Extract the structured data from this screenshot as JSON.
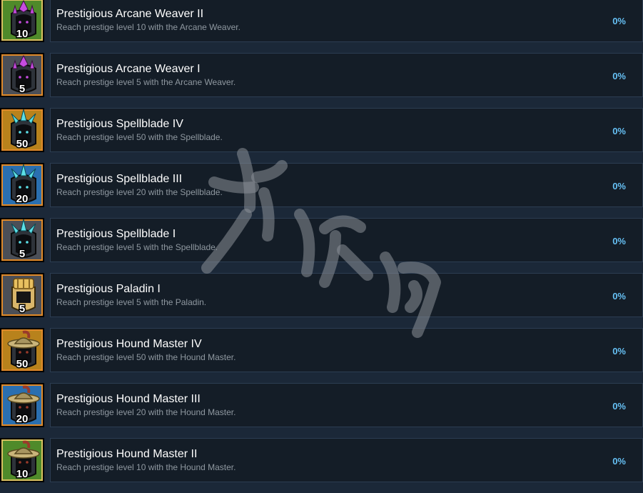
{
  "achievements": [
    {
      "title": "Prestigious Arcane Weaver II",
      "description": "Reach prestige level 10 with the Arcane Weaver.",
      "progress": "0%",
      "level": "10",
      "icon": "arcane-weaver-icon",
      "bg": "#4f8a2a",
      "frame": "#d8c060",
      "crest": "#c64ce0"
    },
    {
      "title": "Prestigious Arcane Weaver I",
      "description": "Reach prestige level 5 with the Arcane Weaver.",
      "progress": "0%",
      "level": "5",
      "icon": "arcane-weaver-icon",
      "bg": "#4b4f57",
      "frame": "#e08a2a",
      "crest": "#c64ce0"
    },
    {
      "title": "Prestigious Spellblade IV",
      "description": "Reach prestige level 50 with the Spellblade.",
      "progress": "0%",
      "level": "50",
      "icon": "spellblade-icon",
      "bg": "#b8821c",
      "frame": "#e08a2a",
      "crest": "#5ce0e8"
    },
    {
      "title": "Prestigious Spellblade III",
      "description": "Reach prestige level 20 with the Spellblade.",
      "progress": "0%",
      "level": "20",
      "icon": "spellblade-icon",
      "bg": "#2a6fb0",
      "frame": "#e08a2a",
      "crest": "#5ce0e8"
    },
    {
      "title": "Prestigious Spellblade I",
      "description": "Reach prestige level 5 with the Spellblade.",
      "progress": "0%",
      "level": "5",
      "icon": "spellblade-icon",
      "bg": "#4b4f57",
      "frame": "#e08a2a",
      "crest": "#5ce0e8"
    },
    {
      "title": "Prestigious Paladin I",
      "description": "Reach prestige level 5 with the Paladin.",
      "progress": "0%",
      "level": "5",
      "icon": "paladin-icon",
      "bg": "#4b4f57",
      "frame": "#e08a2a",
      "crest": "#e8c060"
    },
    {
      "title": "Prestigious Hound Master IV",
      "description": "Reach prestige level 50 with the Hound Master.",
      "progress": "0%",
      "level": "50",
      "icon": "hound-master-icon",
      "bg": "#b8821c",
      "frame": "#e08a2a",
      "crest": "#9a3a2a"
    },
    {
      "title": "Prestigious Hound Master III",
      "description": "Reach prestige level 20 with the Hound Master.",
      "progress": "0%",
      "level": "20",
      "icon": "hound-master-icon",
      "bg": "#2a6fb0",
      "frame": "#e08a2a",
      "crest": "#9a3a2a"
    },
    {
      "title": "Prestigious Hound Master II",
      "description": "Reach prestige level 10 with the Hound Master.",
      "progress": "0%",
      "level": "10",
      "icon": "hound-master-icon",
      "bg": "#4f8a2a",
      "frame": "#d8c060",
      "crest": "#9a3a2a"
    }
  ]
}
